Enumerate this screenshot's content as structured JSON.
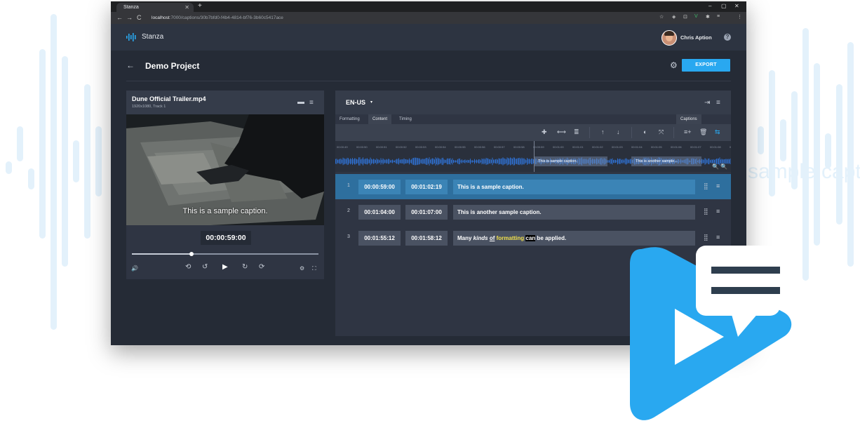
{
  "browser": {
    "tab_title": "Stanza",
    "tab_close": "✕",
    "new_tab": "+",
    "window_controls": [
      "–",
      "▢",
      "✕"
    ],
    "nav": [
      "←",
      "→",
      "C"
    ],
    "url_host": "localhost",
    "url_path": ":7000/captions/30b7bfd0-f4b4-4814-bf76-3b60c5417ace",
    "extensions": [
      "☆",
      "◈",
      "⊡",
      "V",
      "✱",
      "≡",
      "⋮"
    ]
  },
  "app": {
    "name": "Stanza",
    "user_name": "Chris Aption",
    "help": "?"
  },
  "project": {
    "back": "←",
    "title": "Demo Project",
    "settings_icon": "⚙",
    "export_label": "EXPORT"
  },
  "video": {
    "file_name": "Dune Official Trailer.mp4",
    "meta": "1920x1080, Track 1",
    "folder_icon": "▬",
    "menu_icon": "≡",
    "caption": "This is a sample caption.",
    "current_time": "00:00:59:00",
    "progress": 0.32,
    "controls": [
      "🔊",
      "⟲",
      "↺",
      "▶",
      "↻",
      "⟳",
      "⚙",
      "⛶"
    ]
  },
  "captions": {
    "language": "EN-US",
    "caret": "▾",
    "header_icons": [
      "⇥",
      "≡"
    ],
    "tabs": [
      "Formatting",
      "Content",
      "Timing"
    ],
    "active_tab": 1,
    "right_tab": "Captions",
    "tools_left": [
      "✚",
      "⟷",
      "≣",
      "↑",
      "↓",
      "◐",
      "⤧"
    ],
    "tools_right": [
      "≡+",
      "🗑",
      "⇆"
    ],
    "ruler_ticks": [
      "00:00:49",
      "00:00:50",
      "00:00:51",
      "00:00:52",
      "00:00:53",
      "00:00:54",
      "00:00:55",
      "00:00:56",
      "00:00:57",
      "00:00:58",
      "00:00:59",
      "00:01:00",
      "00:01:01",
      "00:01:02",
      "00:01:03",
      "00:01:04",
      "00:01:05",
      "00:01:06",
      "00:01:07",
      "00:01:08",
      "00:01:09"
    ],
    "waveform_captions": [
      "This is sample caption.",
      "This is another sample..."
    ],
    "zoom_icons": [
      "🔍",
      "🔍"
    ],
    "rows": [
      {
        "num": "1",
        "start": "00:00:59:00",
        "end": "00:01:02:19",
        "text": "This is a sample caption."
      },
      {
        "num": "2",
        "start": "00:01:04:00",
        "end": "00:01:07:00",
        "text": "This is another sample caption."
      },
      {
        "num": "3",
        "start": "00:01:55:12",
        "end": "00:01:58:12",
        "text_parts": [
          "Many ",
          "kinds",
          " ",
          "of",
          " ",
          "formatting",
          " ",
          "can",
          " be applied."
        ]
      }
    ],
    "row_icons": [
      "⣿",
      "≡"
    ]
  },
  "background": {
    "watermark": "sample caption"
  },
  "colors": {
    "accent": "#29a8f0",
    "selected_row": "#2e6f9e",
    "panel": "#2f3543",
    "page": "#252b36",
    "wave": "#2f6fd0",
    "logo": "#29a8f0",
    "logo_dark": "#2e3e4e"
  }
}
